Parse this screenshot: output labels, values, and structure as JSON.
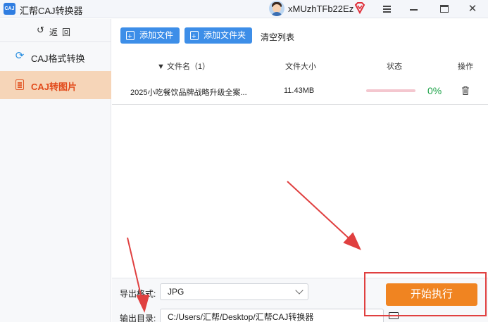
{
  "titlebar": {
    "app_icon_text": "CAJ",
    "app_title": "汇帮CAJ转换器",
    "username": "xMUzhTFb22Ez",
    "close_glyph": "✕"
  },
  "sidebar": {
    "back_label": "返回",
    "back_glyph": "↺",
    "items": [
      {
        "label": "CAJ格式转换",
        "icon": "refresh-icon",
        "active": false
      },
      {
        "label": "CAJ转图片",
        "icon": "document-icon",
        "active": true
      }
    ]
  },
  "toolbar": {
    "add_file_label": "添加文件",
    "add_folder_label": "添加文件夹",
    "clear_list_label": "清空列表"
  },
  "table": {
    "headers": {
      "filename": "▼ 文件名（1）",
      "size": "文件大小",
      "status": "状态",
      "action": "操作"
    },
    "rows": [
      {
        "filename": "2025小吃餐饮品牌战略升级全案...",
        "size": "11.43MB",
        "progress": 0,
        "progress_label": "0%"
      }
    ]
  },
  "bottom": {
    "export_format_label": "导出格式:",
    "export_format_value": "JPG",
    "output_dir_label": "输出目录:",
    "output_dir_value": "C:/Users/汇帮/Desktop/汇帮CAJ转换器",
    "start_button_label": "开始执行"
  },
  "colors": {
    "accent_blue": "#3d8ee8",
    "active_bg": "#f6d5b8",
    "active_text": "#e24a1a",
    "start_button": "#f08421",
    "progress_text": "#1fa34a",
    "annotation_red": "#e04040"
  }
}
